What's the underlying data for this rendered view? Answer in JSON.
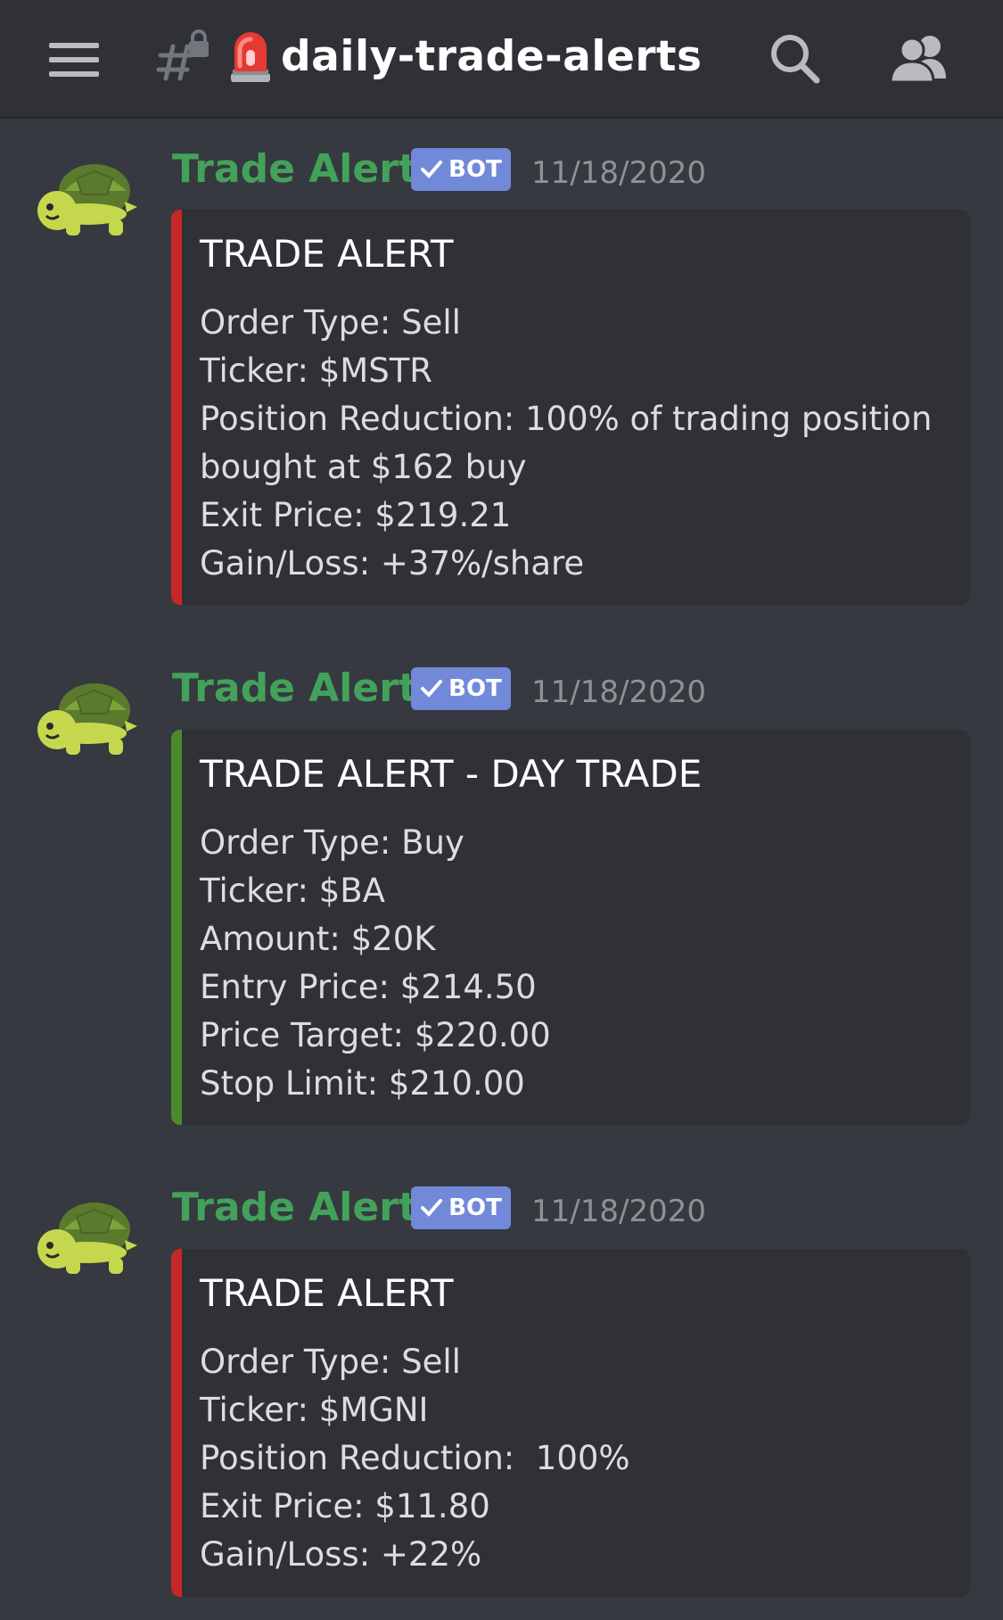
{
  "header": {
    "channel_name": "daily-trade-alerts",
    "icons": {
      "menu": "hamburger-menu-icon",
      "channel": "hash-lock-icon",
      "emoji": "rotating-light-emoji",
      "search": "search-icon",
      "members": "members-icon"
    }
  },
  "colors": {
    "background": "#36393f",
    "topbar": "#2f3136",
    "embed_bg": "#2f3136",
    "author": "#43a25a",
    "bot_tag": "#7289da",
    "timestamp": "#8e9297",
    "sell_bar": "#c62828",
    "buy_bar": "#4b8a2c"
  },
  "messages": [
    {
      "author": "Trade Alerts",
      "bot_label": "BOT",
      "timestamp": "11/18/2020",
      "avatar_icon": "turtle-avatar-icon",
      "embed": {
        "accent": "sell",
        "title": "TRADE ALERT",
        "lines": [
          "Order Type: Sell",
          "Ticker: $MSTR",
          "Position Reduction: 100% of trading position",
          "bought at $162 buy",
          "Exit Price: $219.21",
          "Gain/Loss: +37%/share"
        ]
      }
    },
    {
      "author": "Trade Alerts",
      "bot_label": "BOT",
      "timestamp": "11/18/2020",
      "avatar_icon": "turtle-avatar-icon",
      "embed": {
        "accent": "buy",
        "title": "TRADE ALERT - DAY TRADE",
        "lines": [
          "Order Type: Buy",
          "Ticker: $BA",
          "Amount: $20K",
          "Entry Price: $214.50",
          "Price Target: $220.00",
          "Stop Limit: $210.00"
        ]
      }
    },
    {
      "author": "Trade Alerts",
      "bot_label": "BOT",
      "timestamp": "11/18/2020",
      "avatar_icon": "turtle-avatar-icon",
      "embed": {
        "accent": "sell",
        "title": "TRADE ALERT",
        "lines": [
          "Order Type: Sell",
          "Ticker: $MGNI",
          "Position Reduction:  100%",
          "Exit Price: $11.80",
          "Gain/Loss: +22%"
        ]
      }
    }
  ]
}
